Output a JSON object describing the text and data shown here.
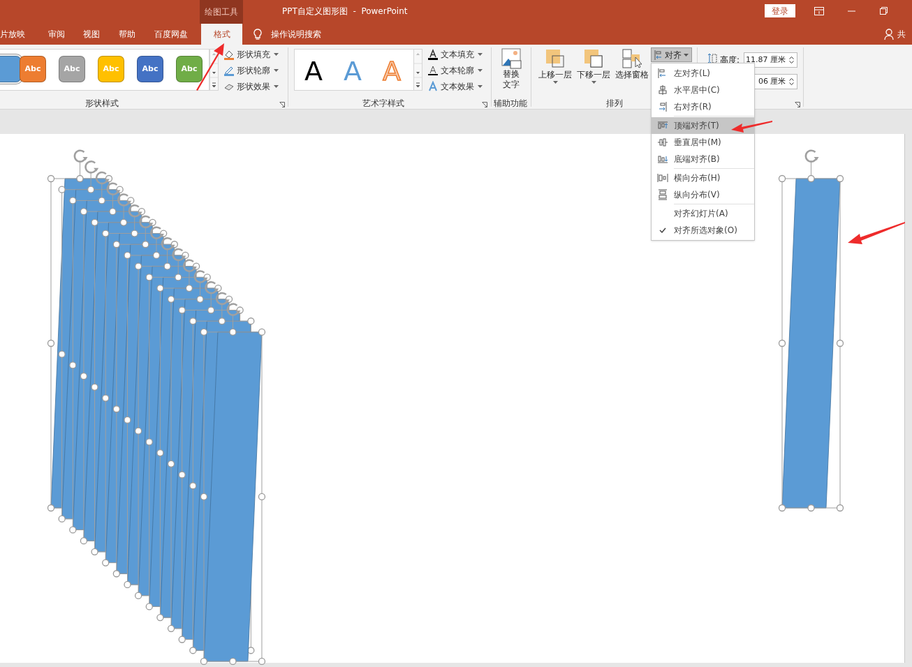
{
  "title_bar": {
    "context_tab": "绘图工具",
    "title": "PPT自定义图形图  -  PowerPoint",
    "login": "登录"
  },
  "tabs": [
    {
      "label": "片放映",
      "selected": false
    },
    {
      "label": "审阅",
      "selected": false
    },
    {
      "label": "视图",
      "selected": false
    },
    {
      "label": "帮助",
      "selected": false
    },
    {
      "label": "百度网盘",
      "selected": false
    },
    {
      "label": "格式",
      "selected": true
    }
  ],
  "search": {
    "placeholder": "操作说明搜索"
  },
  "share": "共",
  "ribbon": {
    "shape_styles": {
      "label": "形状样式",
      "swatches": [
        {
          "color": "#5b9bd5",
          "selected": true
        },
        {
          "label": "Abc",
          "color": "#ed7d31",
          "selected": false
        },
        {
          "label": "Abc",
          "color": "#a5a5a5",
          "selected": false
        },
        {
          "label": "Abc",
          "color": "#ffc000",
          "selected": false
        },
        {
          "label": "Abc",
          "color": "#4472c4",
          "selected": false
        },
        {
          "label": "Abc",
          "color": "#70ad47",
          "selected": false
        }
      ],
      "commands": [
        "形状填充",
        "形状轮廓",
        "形状效果"
      ]
    },
    "wordart_styles": {
      "label": "艺术字样式",
      "samples": [
        {
          "text": "A",
          "kind": "plain"
        },
        {
          "text": "A",
          "kind": "blue"
        },
        {
          "text": "A",
          "kind": "outline"
        }
      ],
      "commands": [
        "文本填充",
        "文本轮廓",
        "文本效果"
      ]
    },
    "accessibility": {
      "label": "辅助功能",
      "button": "替换文字"
    },
    "arrange": {
      "label": "排列",
      "buttons": [
        "上移一层",
        "下移一层",
        "选择窗格"
      ],
      "align": "对齐"
    },
    "size": {
      "height_label": "高度:",
      "height": "11.87 厘米",
      "width": "06 厘米"
    }
  },
  "align_menu": [
    [
      {
        "label": "左对齐(L)",
        "selected": false,
        "checked": false
      },
      {
        "label": "水平居中(C)",
        "selected": false,
        "checked": false
      },
      {
        "label": "右对齐(R)",
        "selected": false,
        "checked": false
      }
    ],
    [
      {
        "label": "顶端对齐(T)",
        "selected": true,
        "checked": false
      },
      {
        "label": "垂直居中(M)",
        "selected": false,
        "checked": false
      },
      {
        "label": "底端对齐(B)",
        "selected": false,
        "checked": false
      }
    ],
    [
      {
        "label": "横向分布(H)",
        "selected": false,
        "checked": false
      },
      {
        "label": "纵向分布(V)",
        "selected": false,
        "checked": false
      }
    ],
    [
      {
        "label": "对齐幻灯片(A)",
        "selected": false,
        "checked": false
      },
      {
        "label": "对齐所选对象(O)",
        "selected": false,
        "checked": true
      }
    ]
  ]
}
